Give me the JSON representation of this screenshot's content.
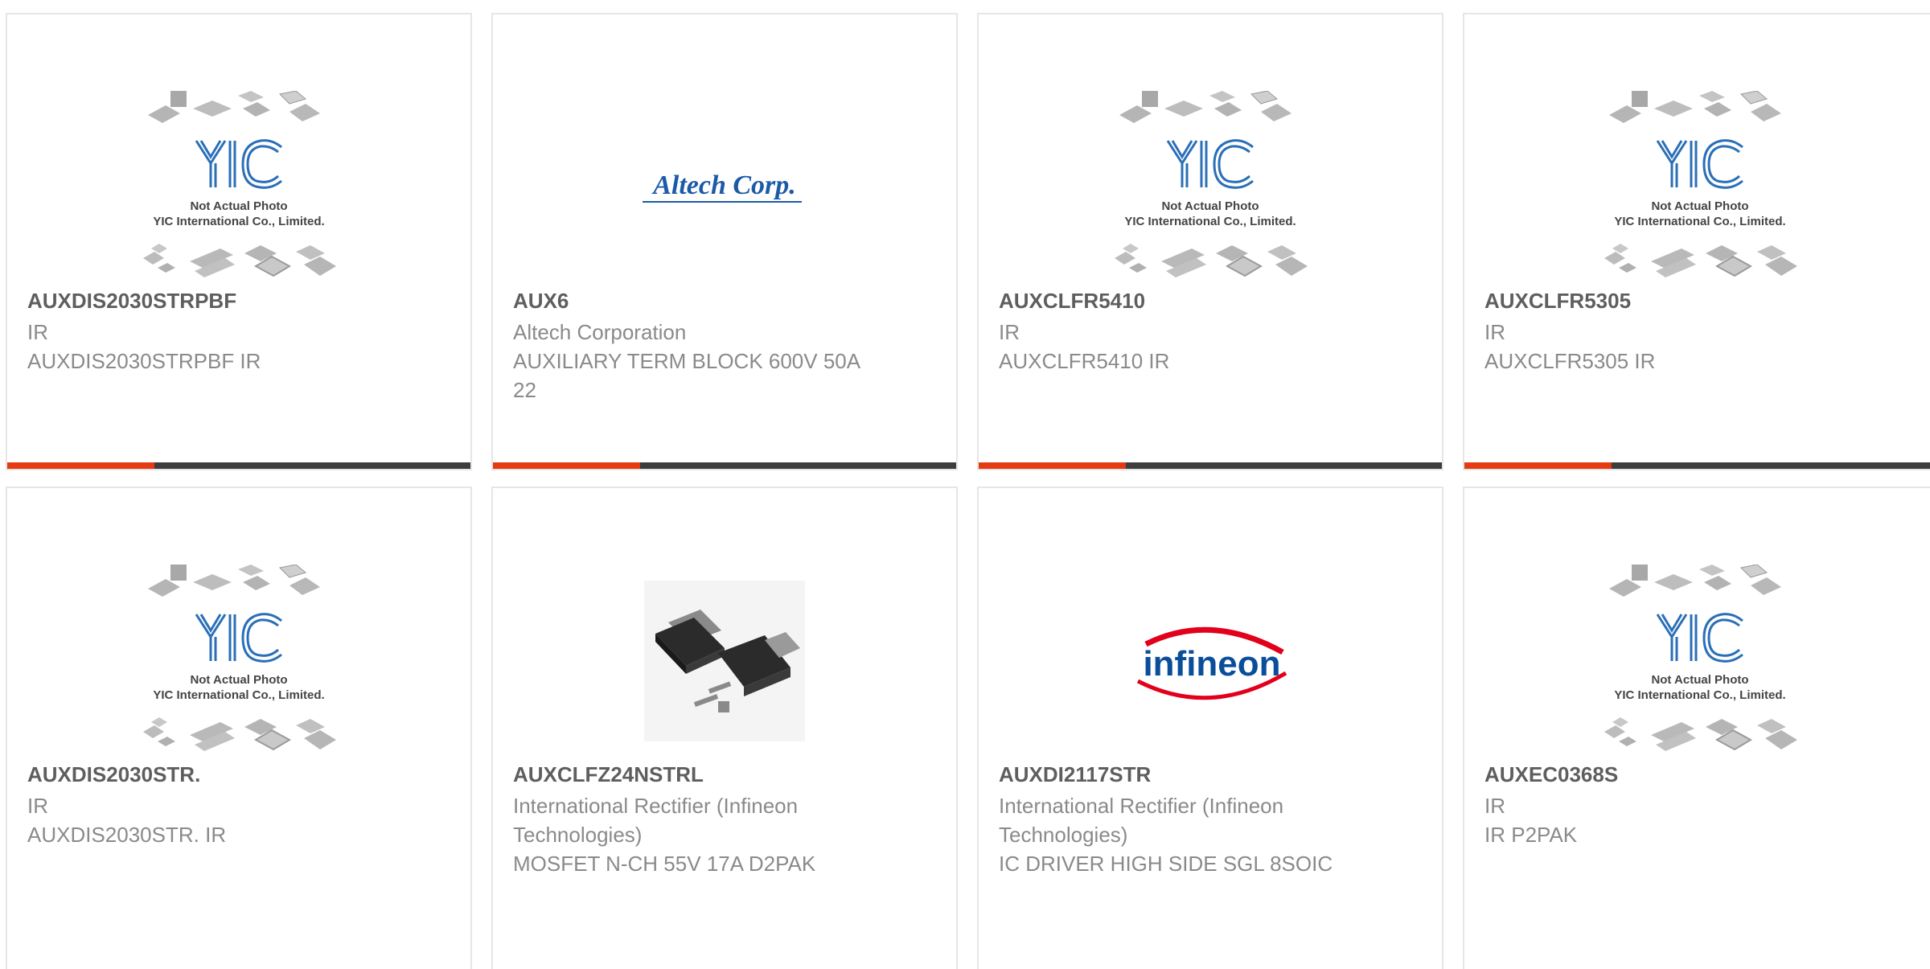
{
  "colors": {
    "accent": "#e63b12",
    "bar": "#3d3d3d",
    "part_number": "#5e5e5e",
    "text": "#8a8a8a",
    "yic_blue": "#2a6fb7",
    "altech_blue": "#1c5aa8",
    "infineon_red": "#e2001a",
    "infineon_blue": "#0a4e9b"
  },
  "products": [
    {
      "image": "yic-placeholder",
      "placeholder_line1": "Not Actual Photo",
      "placeholder_line2": "YIC International Co., Limited.",
      "part_number": "AUXDIS2030STRPBF",
      "manufacturer": "IR",
      "description": "AUXDIS2030STRPBF IR"
    },
    {
      "image": "altech-logo",
      "logo_text": "Altech Corp.",
      "part_number": "AUX6",
      "manufacturer": "Altech Corporation",
      "description": "AUXILIARY TERM BLOCK 600V 50A 22"
    },
    {
      "image": "yic-placeholder",
      "placeholder_line1": "Not Actual Photo",
      "placeholder_line2": "YIC International Co., Limited.",
      "part_number": "AUXCLFR5410",
      "manufacturer": "IR",
      "description": "AUXCLFR5410 IR"
    },
    {
      "image": "yic-placeholder",
      "placeholder_line1": "Not Actual Photo",
      "placeholder_line2": "YIC International Co., Limited.",
      "part_number": "AUXCLFR5305",
      "manufacturer": "IR",
      "description": "AUXCLFR5305 IR"
    },
    {
      "image": "yic-placeholder",
      "placeholder_line1": "Not Actual Photo",
      "placeholder_line2": "YIC International Co., Limited.",
      "part_number": "AUXDIS2030STR.",
      "manufacturer": "IR",
      "description": "AUXDIS2030STR. IR"
    },
    {
      "image": "d2pak-photo",
      "part_number": "AUXCLFZ24NSTRL",
      "manufacturer": "International Rectifier (Infineon Technologies)",
      "description": "MOSFET N-CH 55V 17A D2PAK"
    },
    {
      "image": "infineon-logo",
      "logo_text": "infineon",
      "part_number": "AUXDI2117STR",
      "manufacturer": "International Rectifier (Infineon Technologies)",
      "description": "IC DRIVER HIGH SIDE SGL 8SOIC"
    },
    {
      "image": "yic-placeholder",
      "placeholder_line1": "Not Actual Photo",
      "placeholder_line2": "YIC International Co., Limited.",
      "part_number": "AUXEC0368S",
      "manufacturer": "IR",
      "description": "IR P2PAK"
    }
  ]
}
